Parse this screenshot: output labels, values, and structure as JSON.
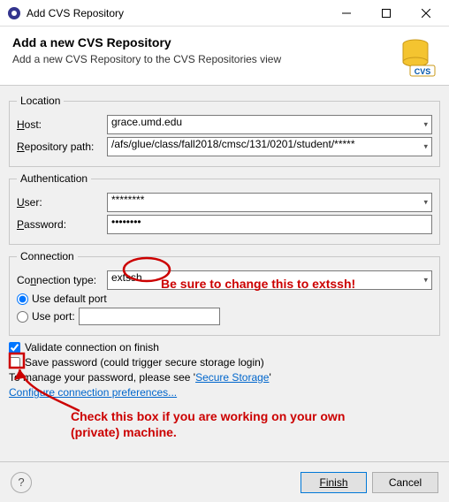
{
  "window": {
    "title": "Add CVS Repository"
  },
  "header": {
    "title": "Add a new CVS Repository",
    "subtitle": "Add a new CVS Repository to the CVS Repositories view",
    "icon_text": "CVS"
  },
  "location": {
    "legend": "Location",
    "host_label_pre": "H",
    "host_label_rest": "ost:",
    "host_value": "grace.umd.edu",
    "repo_label_pre": "R",
    "repo_label_rest": "epository path:",
    "repo_value": "/afs/glue/class/fall2018/cmsc/131/0201/student/*****"
  },
  "auth": {
    "legend": "Authentication",
    "user_label_pre": "U",
    "user_label_rest": "ser:",
    "user_value": "********",
    "pass_label_pre": "P",
    "pass_label_rest": "assword:",
    "pass_value": "••••••••"
  },
  "conn": {
    "legend": "Connection",
    "type_label_pre": "Co",
    "type_label_ul": "n",
    "type_label_rest": "nection type:",
    "type_value": "extssh",
    "default_port_label": "Use default port",
    "use_port_label_pre": "Use por",
    "use_port_label_ul": "t",
    "use_port_label_rest": ":"
  },
  "options": {
    "validate_label": "Validate connection on finish",
    "save_label": "Save password (could trigger secure storage login)",
    "manage_pre": "To manage your password, please see '",
    "manage_link": "Secure Storage",
    "manage_post": "'",
    "configure_link": "Configure connection preferences..."
  },
  "buttons": {
    "finish": "Finish",
    "cancel": "Cancel"
  },
  "annotations": {
    "extssh_note": "Be sure to change this to extssh!",
    "save_note1": "Check this box if you are working on your own",
    "save_note2": "(private) machine."
  }
}
